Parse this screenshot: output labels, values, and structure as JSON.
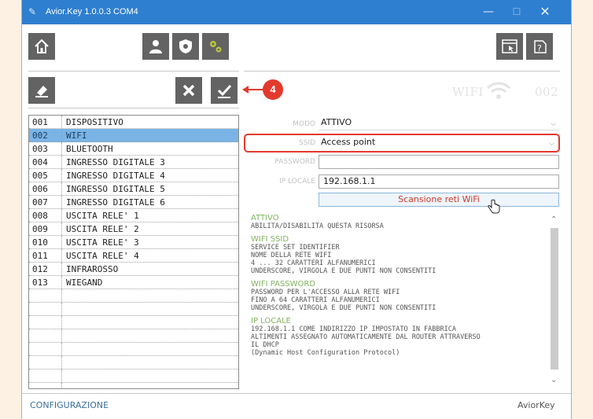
{
  "window": {
    "title": "Avior.Key 1.0.0.3   COM4",
    "icon": "key-icon"
  },
  "toolbar": {
    "left_buttons": [
      "home-icon",
      "user-icon",
      "shield-icon",
      "gears-icon"
    ],
    "right_buttons": [
      "window-cursor-icon",
      "help-icon"
    ],
    "edit_buttons": [
      "eraser-icon",
      "close-icon",
      "check-icon"
    ]
  },
  "status": {
    "label": "WIFI",
    "icon": "wifi-icon",
    "index": "002"
  },
  "callout": {
    "number": "4",
    "color": "#e23a2d"
  },
  "resources": [
    {
      "num": "001",
      "name": "DISPOSITIVO"
    },
    {
      "num": "002",
      "name": "WIFI",
      "selected": true
    },
    {
      "num": "003",
      "name": "BLUETOOTH"
    },
    {
      "num": "004",
      "name": "INGRESSO DIGITALE 3"
    },
    {
      "num": "005",
      "name": "INGRESSO DIGITALE 4"
    },
    {
      "num": "006",
      "name": "INGRESSO DIGITALE 5"
    },
    {
      "num": "007",
      "name": "INGRESSO DIGITALE 6"
    },
    {
      "num": "008",
      "name": "USCITA RELE' 1"
    },
    {
      "num": "009",
      "name": "USCITA RELE' 2"
    },
    {
      "num": "010",
      "name": "USCITA RELE' 3"
    },
    {
      "num": "011",
      "name": "USCITA RELE' 4"
    },
    {
      "num": "012",
      "name": "INFRAROSSO"
    },
    {
      "num": "013",
      "name": "WIEGAND"
    },
    {
      "num": "",
      "name": ""
    },
    {
      "num": "",
      "name": ""
    },
    {
      "num": "",
      "name": ""
    },
    {
      "num": "",
      "name": ""
    },
    {
      "num": "",
      "name": ""
    },
    {
      "num": "",
      "name": ""
    },
    {
      "num": "",
      "name": ""
    },
    {
      "num": "",
      "name": ""
    }
  ],
  "form": {
    "mode_label": "MODO",
    "mode_value": "ATTIVO",
    "ssid_label": "SSID",
    "ssid_value": "Access point",
    "password_label": "PASSWORD",
    "password_value": "",
    "ip_label": "IP LOCALE",
    "ip_value": "192.168.1.1",
    "scan_button": "Scansione reti WiFi"
  },
  "help": [
    {
      "title": "ATTIVO",
      "lines": [
        "ABILITA/DISABILITA QUESTA RISORSA"
      ]
    },
    {
      "title": "WIFI SSID",
      "lines": [
        "SERVICE SET IDENTIFIER",
        "NOME DELLA RETE WIFI",
        "4 ... 32 CARATTERI ALFANUMERICI",
        "UNDERSCORE, VIRGOLA E DUE PUNTI NON CONSENTITI"
      ]
    },
    {
      "title": "WIFI PASSWORD",
      "lines": [
        "PASSWORD PER L'ACCESSO ALLA RETE WIFI",
        "FINO A 64 CARATTERI ALFANUMERICI",
        "UNDERSCORE, VIRGOLA E DUE PUNTI NON CONSENTITI"
      ]
    },
    {
      "title": "IP LOCALE",
      "lines": [
        "192.168.1.1 COME INDIRIZZO IP IMPOSTATO IN FABBRICA",
        "ALTIMENTI ASSEGNATO AUTOMATICAMENTE DAL ROUTER ATTRAVERSO",
        "IL DHCP",
        "(Dynamic Host Configuration Protocol)"
      ]
    }
  ],
  "footer": {
    "left": "CONFIGURAZIONE",
    "right": "AviorKey"
  }
}
